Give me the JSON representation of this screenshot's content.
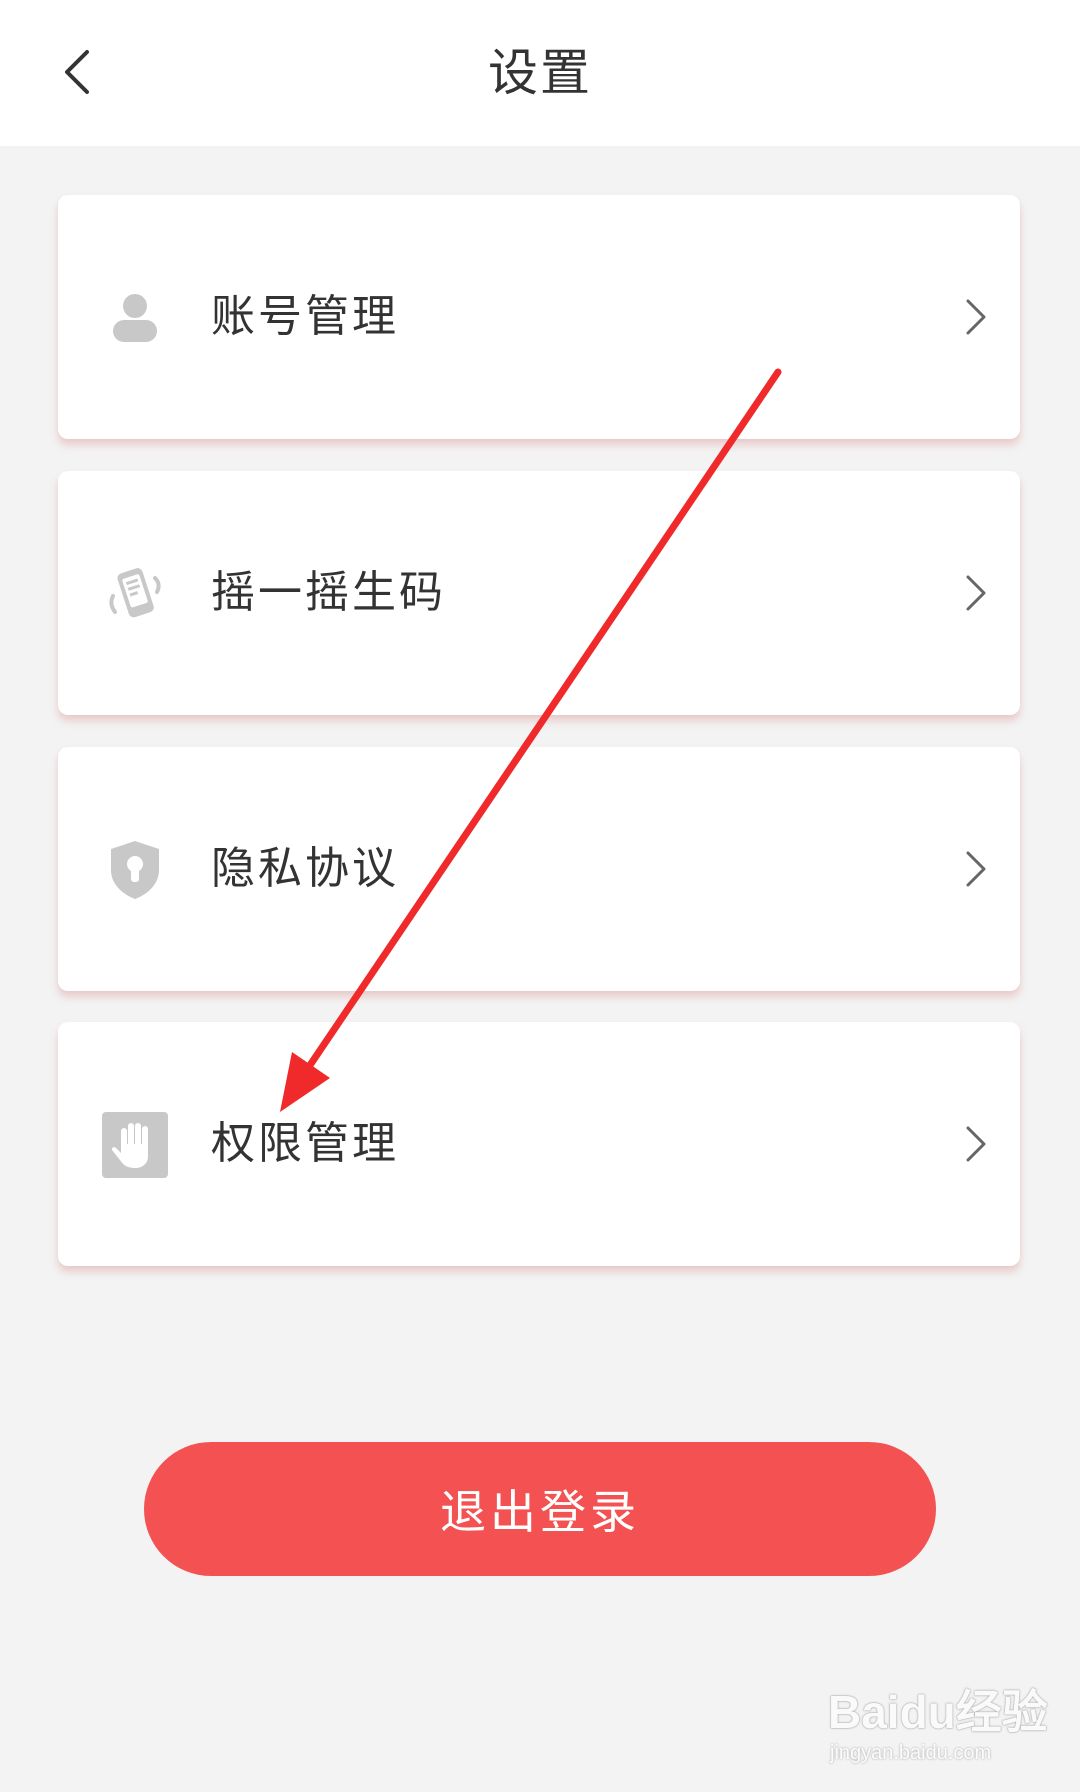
{
  "header": {
    "title": "设置",
    "back_icon": "chevron-left-icon"
  },
  "menu": [
    {
      "label": "账号管理",
      "icon": "user-icon"
    },
    {
      "label": "摇一摇生码",
      "icon": "shake-phone-icon"
    },
    {
      "label": "隐私协议",
      "icon": "shield-lock-icon"
    },
    {
      "label": "权限管理",
      "icon": "hand-icon"
    }
  ],
  "logout": {
    "label": "退出登录"
  },
  "watermark": {
    "logo": "Baidu经验",
    "url": "jingyan.baidu.com"
  },
  "colors": {
    "accent": "#f45252",
    "annotation": "#f02a2a",
    "icon": "#c8c8c8",
    "background": "#f3f3f3"
  }
}
